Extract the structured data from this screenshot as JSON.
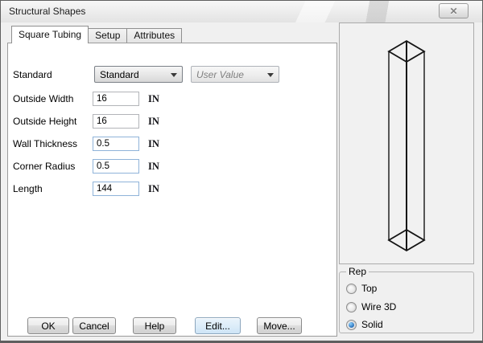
{
  "window": {
    "title": "Structural Shapes",
    "close_glyph": "✕"
  },
  "tabs": [
    {
      "label": "Square Tubing",
      "active": true
    },
    {
      "label": "Setup",
      "active": false
    },
    {
      "label": "Attributes",
      "active": false
    }
  ],
  "form": {
    "standard_label": "Standard",
    "standard_value": "Standard",
    "user_value": "User Value",
    "fields": [
      {
        "label": "Outside Width",
        "value": "16",
        "unit": "IN",
        "accent_border": false
      },
      {
        "label": "Outside Height",
        "value": "16",
        "unit": "IN",
        "accent_border": false
      },
      {
        "label": "Wall Thickness",
        "value": "0.5",
        "unit": "IN",
        "accent_border": true
      },
      {
        "label": "Corner Radius",
        "value": "0.5",
        "unit": "IN",
        "accent_border": true
      },
      {
        "label": "Length",
        "value": "144",
        "unit": "IN",
        "accent_border": true
      }
    ]
  },
  "buttons": [
    {
      "label": "OK",
      "highlighted": false
    },
    {
      "label": "Cancel",
      "highlighted": false
    },
    {
      "label": "Help",
      "highlighted": false
    },
    {
      "label": "Edit...",
      "highlighted": true
    },
    {
      "label": "Move...",
      "highlighted": false
    }
  ],
  "rep": {
    "label": "Rep",
    "options": [
      {
        "label": "Top",
        "selected": false
      },
      {
        "label": "Wire 3D",
        "selected": false
      },
      {
        "label": "Solid",
        "selected": true
      }
    ]
  },
  "preview": {
    "icon": "square-tubing-isometric-wireframe"
  },
  "colors": {
    "dialog_background": "#f0f0f0",
    "panel_background": "#ffffff",
    "accent_field_border": "#8fb3d9",
    "highlighted_button": "#ddedf9",
    "radio_selected": "#2a71b9",
    "wireframe_stroke": "#141414"
  }
}
